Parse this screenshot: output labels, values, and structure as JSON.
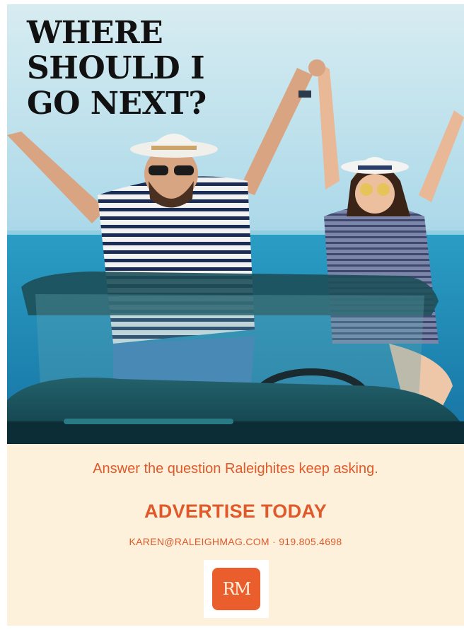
{
  "headline": {
    "line1": "WHERE",
    "line2": "SHOULD I",
    "line3": "GO NEXT?"
  },
  "tagline": "Answer the question Raleighites keep asking.",
  "cta": "ADVERTISE TODAY",
  "contact": "KAREN@RALEIGHMAG.COM · 919.805.4698",
  "logo": {
    "text": "RM"
  },
  "colors": {
    "accent": "#e0592a",
    "background": "#fdf1dc",
    "headline": "#111111",
    "logo": "#ea5d2c"
  }
}
